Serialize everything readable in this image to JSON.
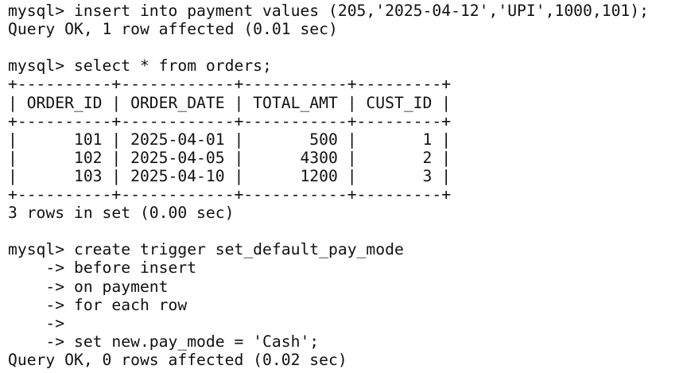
{
  "terminal": {
    "lines": [
      "mysql> insert into payment values (205,'2025-04-12','UPI',1000,101);",
      "Query OK, 1 row affected (0.01 sec)",
      "",
      "mysql> select * from orders;",
      "+----------+------------+-----------+---------+",
      "| ORDER_ID | ORDER_DATE | TOTAL_AMT | CUST_ID |",
      "+----------+------------+-----------+---------+",
      "|      101 | 2025-04-01 |       500 |       1 |",
      "|      102 | 2025-04-05 |      4300 |       2 |",
      "|      103 | 2025-04-10 |      1200 |       3 |",
      "+----------+------------+-----------+---------+",
      "3 rows in set (0.00 sec)",
      "",
      "mysql> create trigger set_default_pay_mode",
      "    -> before insert",
      "    -> on payment",
      "    -> for each row",
      "    ->",
      "    -> set new.pay_mode = 'Cash';",
      "Query OK, 0 rows affected (0.02 sec)"
    ]
  }
}
